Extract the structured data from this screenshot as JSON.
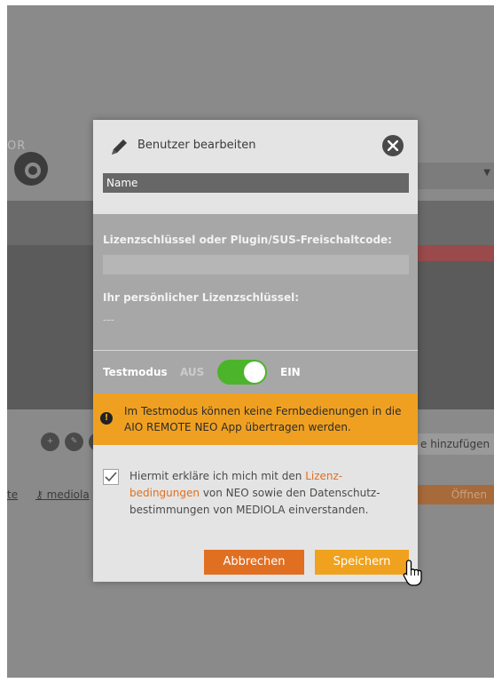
{
  "background": {
    "logo_text": "OR",
    "links": [
      "te",
      "mediola"
    ],
    "add_button": "e hinzufügen",
    "open_button": "Öffnen"
  },
  "modal": {
    "title": "Benutzer bearbeiten",
    "name_field": {
      "value": "Name",
      "placeholder": ""
    },
    "license_label": "Lizenzschlüssel oder Plugin/SUS-Freischaltcode:",
    "license_field": {
      "value": ""
    },
    "personal_license_label": "Ihr persönlicher Lizenzschlüssel:",
    "personal_license_value": "---",
    "test_mode": {
      "label": "Testmodus",
      "off_label": "AUS",
      "on_label": "EIN",
      "enabled": true
    },
    "warning": "Im Testmodus können keine Fernbedienungen in die AIO REMOTE NEO App übertragen werden.",
    "consent": {
      "checked": true,
      "text_before": "Hiermit erkläre ich mich mit den ",
      "link_text": "Lizenz-bedingungen",
      "text_after": " von NEO sowie den Datenschutz-bestimmungen von MEDIOLA einverstanden."
    },
    "cancel_label": "Abbrechen",
    "save_label": "Speichern"
  },
  "colors": {
    "overlay": "#8a8a8a",
    "toggle_on": "#4bb42a",
    "warning_bg": "#f0a021",
    "cancel_bg": "#e06f22",
    "save_bg": "#f0a21e",
    "link": "#e07020"
  }
}
